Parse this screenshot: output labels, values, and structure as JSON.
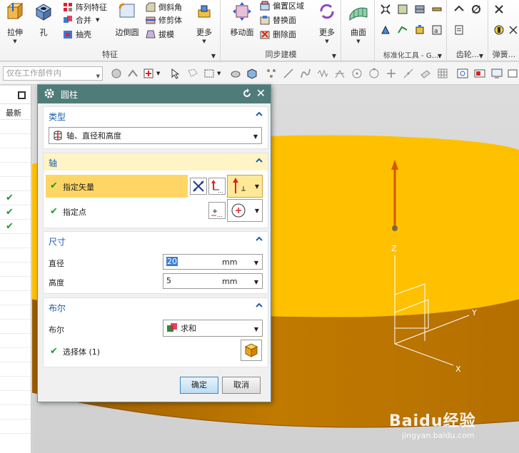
{
  "ribbon": {
    "groups": [
      {
        "name": "特征"
      },
      {
        "name": "同步建模"
      },
      {
        "name": "标准化工具 - G..."
      },
      {
        "name": "齿轮..."
      },
      {
        "name": "弹簧..."
      }
    ],
    "big_buttons": {
      "extrude": "拉伸",
      "hole": "孔",
      "edge_blend": "边倒圆",
      "more1": "更多",
      "move_face": "移动面",
      "more2": "更多",
      "surface": "曲面"
    },
    "small_buttons": {
      "pattern_feature": "阵列特征",
      "unite": "合并",
      "shell": "抽壳",
      "chamfer": "倒斜角",
      "trim_body": "修剪体",
      "draft": "拔模",
      "offset_region": "偏置区域",
      "replace_face": "替换面",
      "delete_face": "删除面"
    }
  },
  "toolbar2": {
    "filter_placeholder": "仅在工作部件内"
  },
  "navigator": {
    "column": "最新",
    "checks": [
      "✔",
      "✔",
      "✔"
    ]
  },
  "dialog": {
    "title": "圆柱",
    "type_section": {
      "header": "类型",
      "value": "轴、直径和高度"
    },
    "axis_section": {
      "header": "轴",
      "specify_vector": "指定矢量",
      "specify_point": "指定点"
    },
    "dims_section": {
      "header": "尺寸",
      "diameter_label": "直径",
      "diameter_value": "20",
      "height_label": "高度",
      "height_value": "5",
      "unit": "mm"
    },
    "boolean_section": {
      "header": "布尔",
      "label": "布尔",
      "value": "求和",
      "select_body": "选择体 (1)"
    },
    "ok": "确定",
    "cancel": "取消"
  },
  "viewport": {
    "axis_z": "Z",
    "axis_x": "X",
    "axis_y": "Y",
    "colors": {
      "cylinder_top": "#ffc000",
      "cylinder_side": "#c07a00",
      "vector_arrow": "#d25a00"
    }
  },
  "watermark": {
    "brand": "Baidu经验",
    "url": "jingyan.baidu.com"
  }
}
